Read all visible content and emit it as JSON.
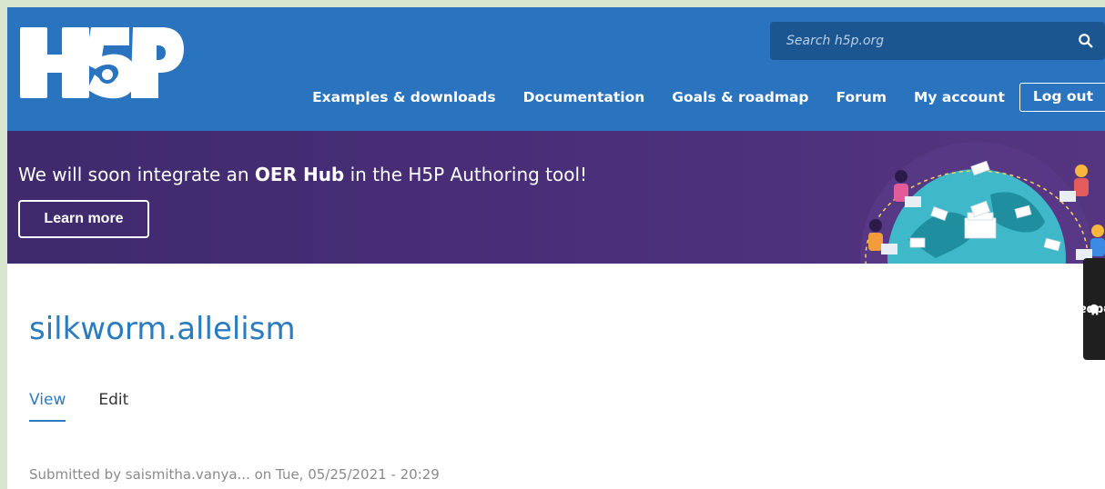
{
  "header": {
    "logo_alt": "H5P",
    "search": {
      "placeholder": "Search h5p.org",
      "value": ""
    },
    "nav": [
      {
        "label": "Examples & downloads"
      },
      {
        "label": "Documentation"
      },
      {
        "label": "Goals & roadmap"
      },
      {
        "label": "Forum"
      },
      {
        "label": "My account"
      }
    ],
    "logout_label": "Log out",
    "colors": {
      "header_bg": "#2a73bf",
      "search_bg": "#1b5691"
    }
  },
  "banner": {
    "text_before": "We will soon integrate an ",
    "text_bold": "OER Hub",
    "text_after": " in the H5P Authoring tool!",
    "button_label": "Learn more",
    "colors": {
      "bg": "#4a2f7a"
    }
  },
  "page": {
    "title": "silkworm.allelism",
    "tabs": [
      {
        "label": "View",
        "active": true
      },
      {
        "label": "Edit",
        "active": false
      }
    ],
    "submitted": "Submitted by saismitha.vanya... on Tue, 05/25/2021 - 20:29",
    "accent": "#2a7bc0"
  },
  "feedback": {
    "label": "feedback",
    "icon": "comment-icon"
  }
}
